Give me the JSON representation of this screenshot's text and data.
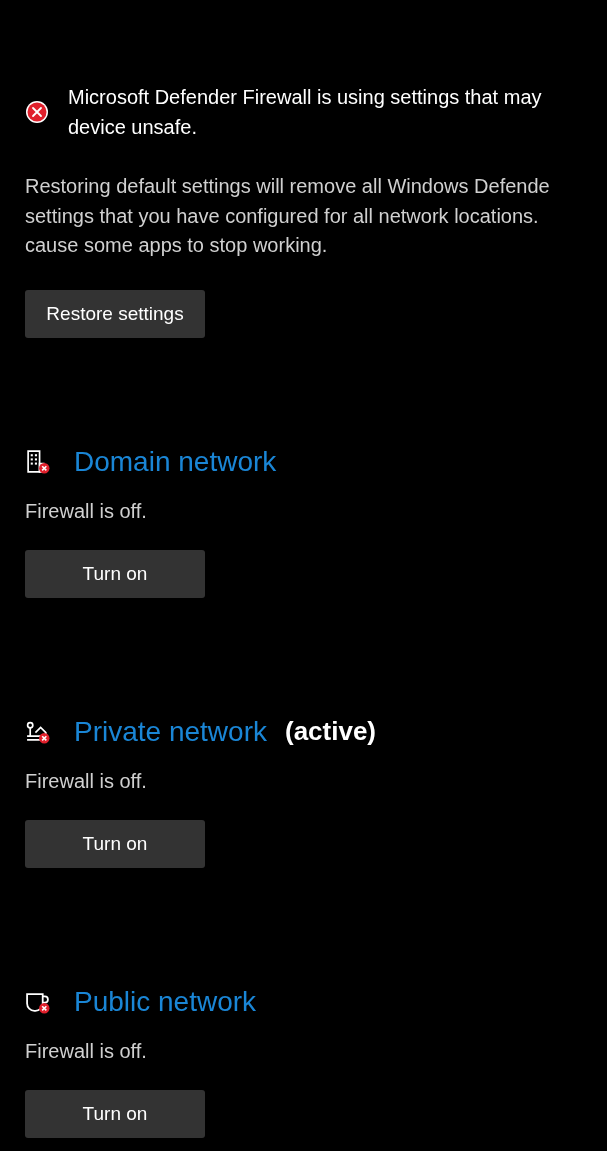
{
  "alert": {
    "kind": "error",
    "lines": [
      "Microsoft Defender Firewall is using settings that may",
      "device unsafe."
    ]
  },
  "description": [
    "Restoring default settings will remove all Windows Defende",
    "settings that you have configured for all network locations.",
    "cause some apps to stop working."
  ],
  "restore_button": "Restore settings",
  "networks": [
    {
      "kind": "domain",
      "name": "Domain network",
      "firewall_on": false,
      "status": "Firewall is off.",
      "button": "Turn on"
    },
    {
      "kind": "private",
      "name": "Private network",
      "active_label": "(active)",
      "firewall_on": false,
      "status": "Firewall is off.",
      "button": "Turn on"
    },
    {
      "kind": "public",
      "name": "Public network",
      "firewall_on": false,
      "status": "Firewall is off.",
      "button": "Turn on"
    }
  ]
}
